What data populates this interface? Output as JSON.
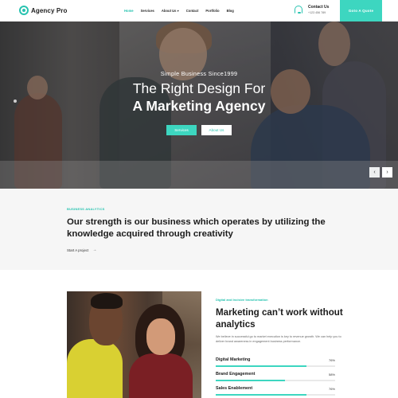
{
  "header": {
    "logo_text": "Agency Pro",
    "nav": [
      "Home",
      "Services",
      "About Us ▾",
      "Contact",
      "Portfolio",
      "Blog"
    ],
    "contact_title": "Contact Us",
    "contact_phone": "+123 456 789",
    "quote_button": "Goto A Quote",
    "accent_color": "#3dd6c0"
  },
  "hero": {
    "subtitle": "Simple Business Since1999",
    "title_line1": "The Right Design For",
    "title_line2": "A Marketing Agency",
    "primary_button": "Services",
    "secondary_button": "About Us",
    "prev_arrow": "‹",
    "next_arrow": "›"
  },
  "business": {
    "tag": "BUSINESS ANALYTICS",
    "title": "Our strength is our business which operates by utilizing the knowledge acquired through creativity",
    "link": "Start A project",
    "link_arrow": "→"
  },
  "analytics": {
    "tag": "Digital and Incisive transformation",
    "title": "Marketing can’t work without analytics",
    "description": "We believe in successful go to market execution is key to revenue growth. We can help you to deliver brand awareness in engagement business performance.",
    "skills": [
      {
        "label": "Digital Marketing",
        "percent": "76%",
        "value": 0.76
      },
      {
        "label": "Brand Engagement",
        "percent": "58%",
        "value": 0.58
      },
      {
        "label": "Sales Enablement",
        "percent": "76%",
        "value": 0.76
      }
    ]
  }
}
